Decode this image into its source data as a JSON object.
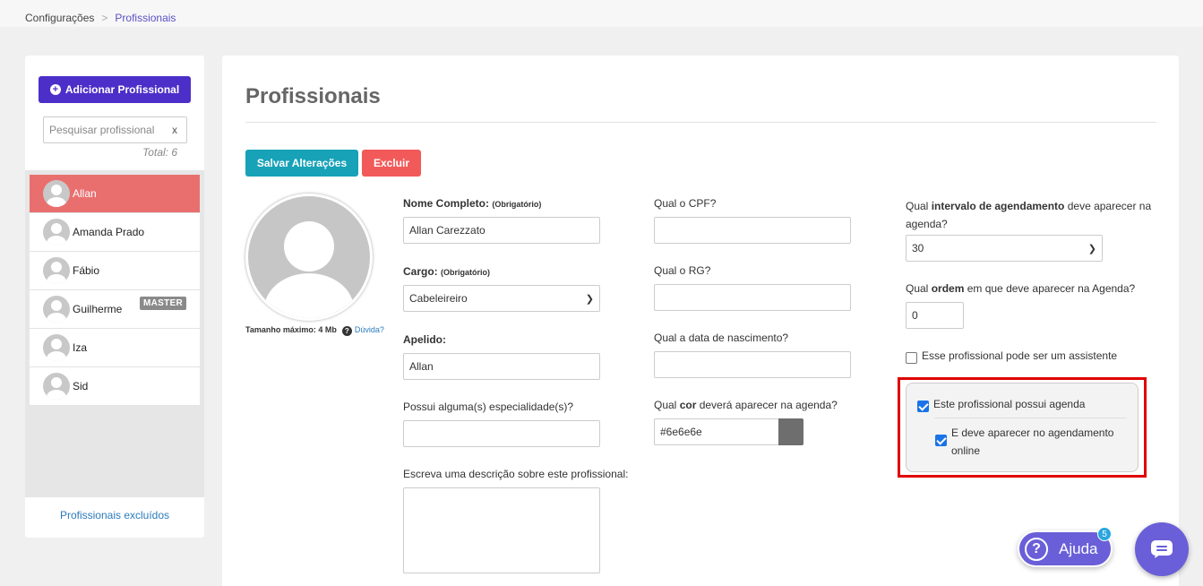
{
  "breadcrumb": {
    "root": "Configurações",
    "separator": ">",
    "current": "Profissionais"
  },
  "sidebar": {
    "add_button": "Adicionar Profissional",
    "search_placeholder": "Pesquisar profissional",
    "search_clear": "x",
    "total": "Total: 6",
    "items": [
      {
        "name": "Allan",
        "active": true
      },
      {
        "name": "Amanda Prado"
      },
      {
        "name": "Fábio"
      },
      {
        "name": "Guilherme",
        "badge": "MASTER"
      },
      {
        "name": "Iza"
      },
      {
        "name": "Sid"
      }
    ],
    "excluded_link": "Profissionais excluídos"
  },
  "main": {
    "title": "Profissionais",
    "save_button": "Salvar Alterações",
    "delete_button": "Excluir",
    "photo_note": "Tamanho máximo: 4 Mb",
    "photo_help": "?",
    "photo_help_link": "Dúvida?",
    "fields": {
      "full_name_label": "Nome Completo:",
      "full_name_required": "(Obrigatório)",
      "full_name_value": "Allan Carezzato",
      "role_label": "Cargo:",
      "role_required": "(Obrigatório)",
      "role_value": "Cabeleireiro",
      "nickname_label": "Apelido:",
      "nickname_value": "Allan",
      "specialty_label": "Possui alguma(s) especialidade(s)?",
      "specialty_value": "",
      "description_label": "Escreva uma descrição sobre este profissional:",
      "cpf_label": "Qual o CPF?",
      "rg_label": "Qual o RG?",
      "birth_label": "Qual a data de nascimento?",
      "color_label_pre": "Qual ",
      "color_label_bold": "cor",
      "color_label_post": " deverá aparecer na agenda?",
      "color_value": "#6e6e6e",
      "interval_label_pre": "Qual ",
      "interval_label_bold": "intervalo de agendamento",
      "interval_label_post": " deve aparecer na",
      "interval_label_line2": "agenda?",
      "interval_value": "30",
      "order_label_pre": "Qual ",
      "order_label_bold": "ordem",
      "order_label_post": " em que deve aparecer na Agenda?",
      "order_value": "0",
      "assistant_label": "Esse profissional pode ser um assistente",
      "has_agenda_label": "Este profissional possui agenda",
      "online_label_line1": "E deve aparecer no agendamento",
      "online_label_line2": "online"
    }
  },
  "floating": {
    "help_label": "Ajuda",
    "help_icon": "?",
    "help_count": "5"
  },
  "colors": {
    "accent": "#4c2fc9",
    "save": "#17a2b8",
    "delete": "#f25a5a",
    "active_row": "#e96f6f",
    "highlight_frame": "#e00000"
  }
}
